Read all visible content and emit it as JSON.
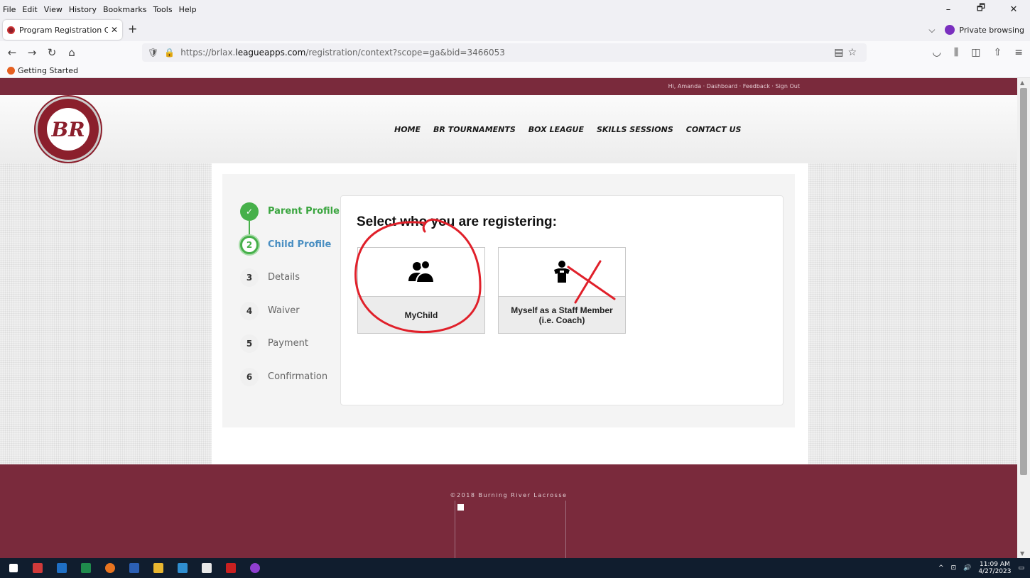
{
  "menu": [
    "File",
    "Edit",
    "View",
    "History",
    "Bookmarks",
    "Tools",
    "Help"
  ],
  "window_controls": {
    "minimize": "–",
    "maximize": "🗗",
    "close": "✕"
  },
  "tab": {
    "title": "Program Registration Context :",
    "close": "✕",
    "new": "+"
  },
  "private": {
    "label": "Private browsing",
    "chevron": "⌵"
  },
  "address": {
    "prefix": "https://brlax.",
    "domain": "leagueapps.com",
    "path": "/registration/context?scope=ga&bid=3466053"
  },
  "bookmarks": {
    "item": "Getting Started"
  },
  "site": {
    "toplinks": "Hi, Amanda · Dashboard · Feedback · Sign Out",
    "logo_text": "BR",
    "nav": [
      "HOME",
      "BR TOURNAMENTS",
      "BOX LEAGUE",
      "SKILLS SESSIONS",
      "CONTACT US"
    ]
  },
  "steps": [
    {
      "num": "✓",
      "label": "Parent Profile",
      "state": "done"
    },
    {
      "num": "2",
      "label": "Child Profile",
      "state": "current"
    },
    {
      "num": "3",
      "label": "Details",
      "state": "todo"
    },
    {
      "num": "4",
      "label": "Waiver",
      "state": "todo"
    },
    {
      "num": "5",
      "label": "Payment",
      "state": "todo"
    },
    {
      "num": "6",
      "label": "Confirmation",
      "state": "todo"
    }
  ],
  "card": {
    "title": "Select who you are registering:",
    "options": [
      {
        "label": "MyChild",
        "icon": "users-icon"
      },
      {
        "label": "Myself as a Staff Member (i.e. Coach)",
        "icon": "staff-icon"
      }
    ]
  },
  "footer": {
    "copyright": "©2018 Burning River Lacrosse"
  },
  "clock": {
    "time": "11:09 AM",
    "date": "4/27/2023"
  },
  "colors": {
    "brand": "#7a2a3c",
    "step_done": "#46b04a",
    "step_current": "#4a8fc2",
    "annotation": "#e0202a"
  }
}
